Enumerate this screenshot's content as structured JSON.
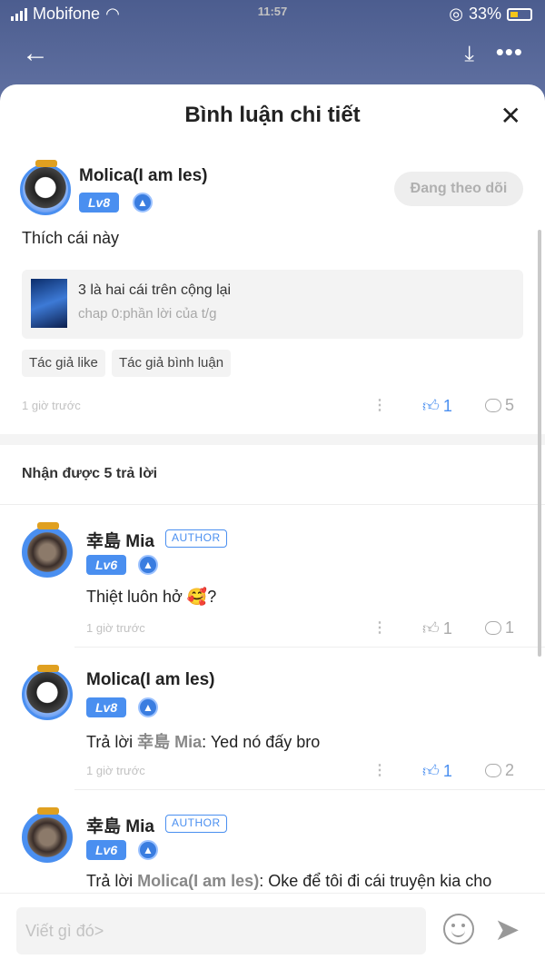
{
  "status": {
    "carrier": "Mobifone",
    "time": "11:57",
    "battery": "33%"
  },
  "sheet": {
    "title": "Bình luận chi tiết"
  },
  "main_comment": {
    "user": "Molica(I am les)",
    "level": "Lv8",
    "follow_label": "Đang theo dõi",
    "text": "Thích cái này",
    "quote": {
      "title": "3 là hai cái trên cộng lại",
      "subtitle": "chap 0:phần lời của t/g"
    },
    "tags": [
      "Tác giả like",
      "Tác giả bình luận"
    ],
    "time": "1 giờ trước",
    "likes": "1",
    "comments": "5"
  },
  "replies_header": "Nhận được 5 trả lời",
  "replies": [
    {
      "user": "幸島 Mia",
      "badge": "AUTHOR",
      "level": "Lv6",
      "text": "Thiệt luôn hở 🥰?",
      "time": "1 giờ trước",
      "likes": "1",
      "comments": "1"
    },
    {
      "user": "Molica(I am les)",
      "level": "Lv8",
      "reply_prefix": "Trả lời ",
      "reply_to": "幸島 Mia",
      "text": ": Yed nó đấy bro",
      "time": "1 giờ trước",
      "likes": "1",
      "comments": "2"
    },
    {
      "user": "幸島 Mia",
      "badge": "AUTHOR",
      "level": "Lv6",
      "reply_prefix": "Trả lời ",
      "reply_to": "Molica(I am les)",
      "text": ": Oke để tôi đi cái truyện kia cho"
    }
  ],
  "composer": {
    "placeholder": "Viết gì đó>"
  },
  "colors": {
    "accent": "#4a8ff0",
    "muted": "#c2c2c2"
  }
}
